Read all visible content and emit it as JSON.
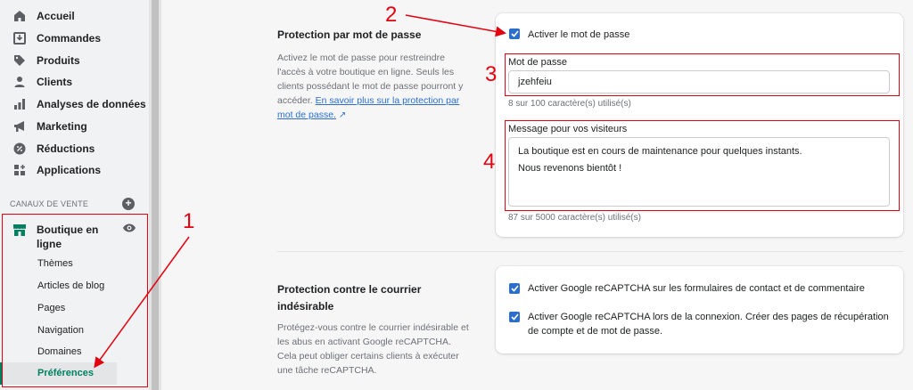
{
  "sidebar": {
    "items": [
      {
        "label": "Accueil",
        "icon": "home-icon"
      },
      {
        "label": "Commandes",
        "icon": "orders-icon"
      },
      {
        "label": "Produits",
        "icon": "tag-icon"
      },
      {
        "label": "Clients",
        "icon": "person-icon"
      },
      {
        "label": "Analyses de données",
        "icon": "analytics-icon"
      },
      {
        "label": "Marketing",
        "icon": "megaphone-icon"
      },
      {
        "label": "Réductions",
        "icon": "discount-icon"
      },
      {
        "label": "Applications",
        "icon": "apps-icon"
      }
    ],
    "sales_channels_label": "CANAUX DE VENTE",
    "add_channel": "+",
    "store": {
      "label": "Boutique en ligne",
      "subitems": [
        "Thèmes",
        "Articles de blog",
        "Pages",
        "Navigation",
        "Domaines"
      ],
      "active_subitem": "Préférences"
    }
  },
  "password_section": {
    "title": "Protection par mot de passe",
    "description": "Activez le mot de passe pour restreindre l'accès à votre boutique en ligne. Seuls les clients possédant le mot de passe pourront y accéder.",
    "link": "En savoir plus sur la protection par mot de passe.",
    "enable_label": "Activer le mot de passe",
    "password_label": "Mot de passe",
    "password_value": "jzehfeiu",
    "password_help": "8 sur 100 caractère(s) utilisé(s)",
    "message_label": "Message pour vos visiteurs",
    "message_line1": "La boutique est en cours de maintenance pour quelques instants.",
    "message_line2": "Nous revenons bientôt !",
    "message_help": "87 sur 5000 caractère(s) utilisé(s)"
  },
  "spam_section": {
    "title": "Protection contre le courrier indésirable",
    "description": "Protégez-vous contre le courrier indésirable et les abus en activant Google reCAPTCHA. Cela peut obliger certains clients à exécuter une tâche reCAPTCHA.",
    "recaptcha_forms_label": "Activer Google reCAPTCHA sur les formulaires de contact et de commentaire",
    "recaptcha_login_label": "Activer Google reCAPTCHA lors de la connexion. Créer des pages de récupération de compte et de mot de passe."
  },
  "annotations": [
    "1",
    "2",
    "3",
    "4"
  ],
  "colors": {
    "accent": "#2c6ecb",
    "annotation": "#e3000f",
    "active_green": "#008060"
  }
}
